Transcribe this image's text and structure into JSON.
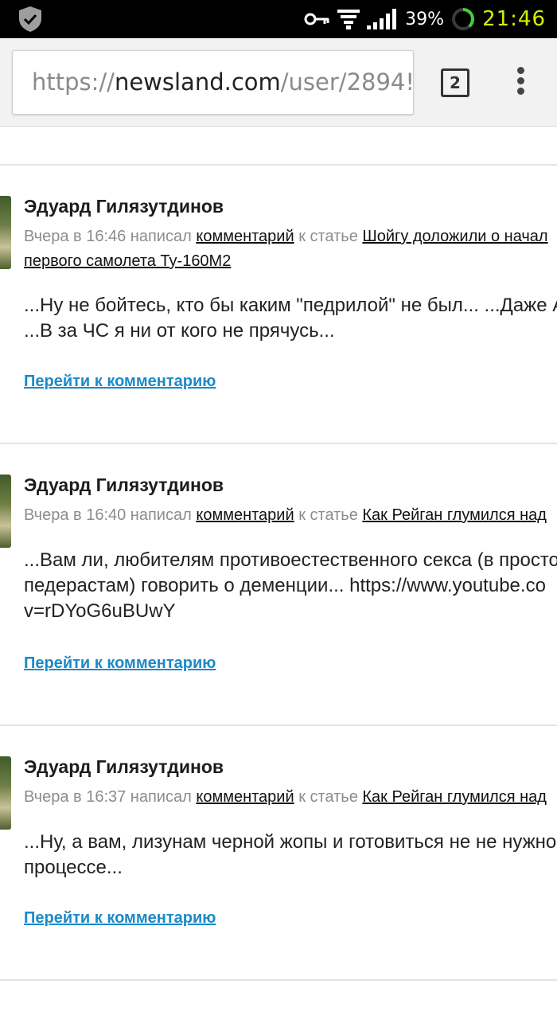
{
  "status_bar": {
    "battery_percent": "39%",
    "time": "21:46",
    "icons": [
      "shield-check-icon",
      "vpn-key-icon",
      "wifi-icon",
      "signal-icon",
      "battery-ring-icon"
    ]
  },
  "browser": {
    "url_prefix": "https://",
    "url_host": "newsland.com",
    "url_path": "/user/2894!",
    "tab_count": "2",
    "menu_icon": "overflow-menu-icon"
  },
  "comments": [
    {
      "author": "Эдуард Гилязутдинов",
      "time_text": "Вчера в 16:46 написал",
      "comment_link": "комментарий",
      "to_article": "к статье",
      "article_title_line1": "Шойгу доложили о начал",
      "article_title_line2": "первого самолета Ту-160М2",
      "body_lines": [
        "...Ну не бойтесь, кто бы каким \"педрилой\" не был... ...Даже А",
        "...В за ЧС я ни от кого не прячусь..."
      ],
      "goto_label": "Перейти к комментарию"
    },
    {
      "author": "Эдуард Гилязутдинов",
      "time_text": "Вчера в 16:40 написал",
      "comment_link": "комментарий",
      "to_article": "к статье",
      "article_title_line1": "Как Рейган глумился над",
      "article_title_line2": "",
      "body_lines": [
        "...Вам ли, любителям противоестественного секса (в просто",
        "педерастам) говорить о деменции... https://www.youtube.co",
        "v=rDYoG6uBUwY"
      ],
      "goto_label": "Перейти к комментарию"
    },
    {
      "author": "Эдуард Гилязутдинов",
      "time_text": "Вчера в 16:37 написал",
      "comment_link": "комментарий",
      "to_article": "к статье",
      "article_title_line1": "Как Рейган глумился над",
      "article_title_line2": "",
      "body_lines": [
        "...Ну, а вам, лизунам черной жопы и готовиться не не нужно",
        "процессе..."
      ],
      "goto_label": "Перейти к комментарию"
    }
  ]
}
